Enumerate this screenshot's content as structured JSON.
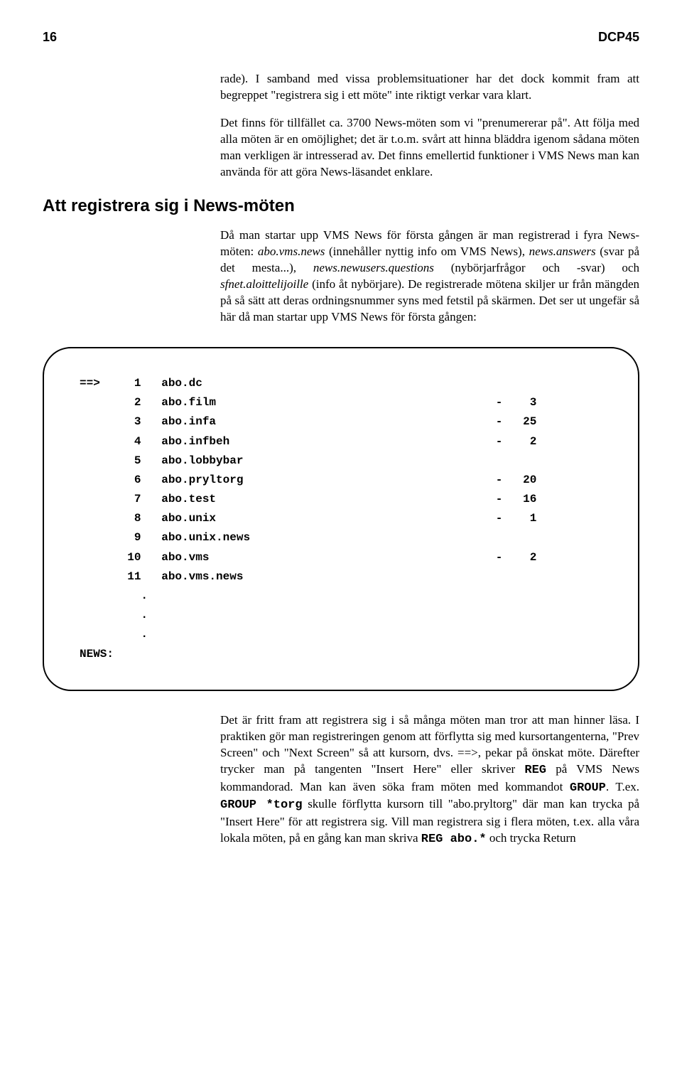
{
  "header": {
    "page_number": "16",
    "doc_code": "DCP45"
  },
  "para1": "rade). I samband med vissa problemsituationer har det dock kommit fram att begreppet \"registrera sig i ett möte\" inte riktigt verkar vara klart.",
  "para2": "Det finns för tillfället ca. 3700 News-möten som vi \"prenumererar på\". Att följa med alla möten är en omöjlighet; det är t.o.m. svårt att hinna bläddra igenom sådana möten man verkligen är intresserad av. Det finns emellertid funktioner i VMS News man kan använda för att göra News-läsandet enklare.",
  "section_heading": "Att registrera sig i News-möten",
  "para3_parts": {
    "t1": "Då man startar upp VMS News för första gången är man registrerad i fyra News-möten: ",
    "i1": "abo.vms.news",
    "t2": " (innehåller nyttig info om VMS News), ",
    "i2": "news.answers",
    "t3": " (svar på det mesta...), ",
    "i3": "news.newusers.questions",
    "t4": " (nybörjarfrågor och -svar) och ",
    "i4": "sfnet.aloittelijoille",
    "t5": " (info åt nybörjare). De registrerade mötena skiljer ur från mängden på så sätt att deras ordningsnummer syns med fetstil på skärmen. Det ser ut ungefär så här då man startar upp VMS News för första gången:"
  },
  "terminal": "==>     1   abo.dc\n        2   abo.film                                         -    3\n        3   abo.infa                                         -   25\n        4   abo.infbeh                                       -    2\n        5   abo.lobbybar\n        6   abo.pryltorg                                     -   20\n        7   abo.test                                         -   16\n        8   abo.unix                                         -    1\n        9   abo.unix.news\n       10   abo.vms                                          -    2\n       11   abo.vms.news\n         .\n         .\n         .\nNEWS:",
  "para4_parts": {
    "t1": "Det är fritt fram att registrera sig i så många möten man tror att man hinner läsa. I praktiken gör man registreringen genom att förflytta sig med kursortangenterna, \"Prev Screen\" och \"Next Screen\" så att kursorn, dvs. ==>, pekar på önskat möte. Därefter trycker man på tangenten \"Insert Here\" eller skriver ",
    "m1": "REG",
    "t2": " på VMS News kommandorad. Man kan även söka fram möten med kommandot ",
    "m2": "GROUP",
    "t3": ". T.ex. ",
    "m3": "GROUP *torg",
    "t4": " skulle förflytta kursorn till \"abo.pryltorg\" där man kan trycka på \"Insert Here\" för att registrera sig. Vill man registrera sig i flera möten, t.ex. alla våra lokala möten, på en gång kan man skriva ",
    "m4": "REG abo.*",
    "t5": " och trycka Return"
  }
}
